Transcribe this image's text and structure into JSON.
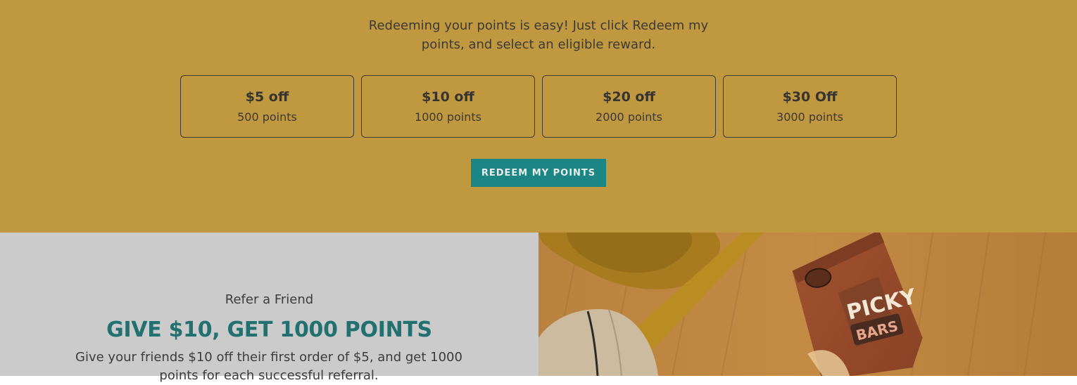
{
  "redeem": {
    "intro": "Redeeming your points is easy! Just click Redeem my points, and select an eligible reward.",
    "rewards": [
      {
        "title": "$5 off",
        "points": "500 points"
      },
      {
        "title": "$10 off",
        "points": "1000 points"
      },
      {
        "title": "$20 off",
        "points": "2000 points"
      },
      {
        "title": "$30 Off",
        "points": "3000 points"
      }
    ],
    "button_label": "REDEEM MY POINTS"
  },
  "refer": {
    "eyebrow": "Refer a Friend",
    "heading": "GIVE $10, GET 1000 POINTS",
    "description": "Give your friends $10 off their first order of $5, and get 1000 points for each successful referral."
  },
  "product": {
    "brand_top": "PICKY",
    "brand_bottom": "BARS"
  },
  "colors": {
    "redeem_bg": "#c0983f",
    "accent_teal": "#1b8684",
    "heading_teal": "#22706f",
    "refer_bg": "#cbcbcb"
  }
}
